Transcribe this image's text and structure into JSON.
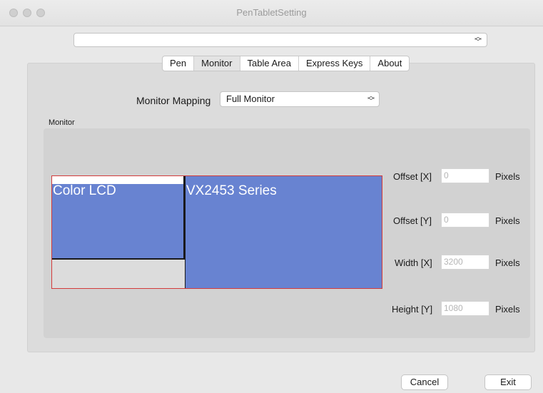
{
  "window": {
    "title": "PenTabletSetting"
  },
  "device_select": {
    "value": ""
  },
  "tabs": [
    {
      "label": "Pen"
    },
    {
      "label": "Monitor"
    },
    {
      "label": "Table Area"
    },
    {
      "label": "Express Keys"
    },
    {
      "label": "About"
    }
  ],
  "active_tab": "Monitor",
  "mapping": {
    "label": "Monitor Mapping",
    "value": "Full Monitor"
  },
  "group": {
    "label": "Monitor"
  },
  "monitors": [
    {
      "name": "Color LCD"
    },
    {
      "name": "VX2453 Series"
    }
  ],
  "fields": [
    {
      "label": "Offset [X]",
      "value": "0",
      "unit": "Pixels"
    },
    {
      "label": "Offset [Y]",
      "value": "0",
      "unit": "Pixels"
    },
    {
      "label": "Width [X]",
      "value": "3200",
      "unit": "Pixels"
    },
    {
      "label": "Height [Y]",
      "value": "1080",
      "unit": "Pixels"
    }
  ],
  "buttons": {
    "cancel": "Cancel",
    "exit": "Exit"
  },
  "colors": {
    "monitor_fill": "#6883d1",
    "mapping_border": "#d33b3b"
  }
}
